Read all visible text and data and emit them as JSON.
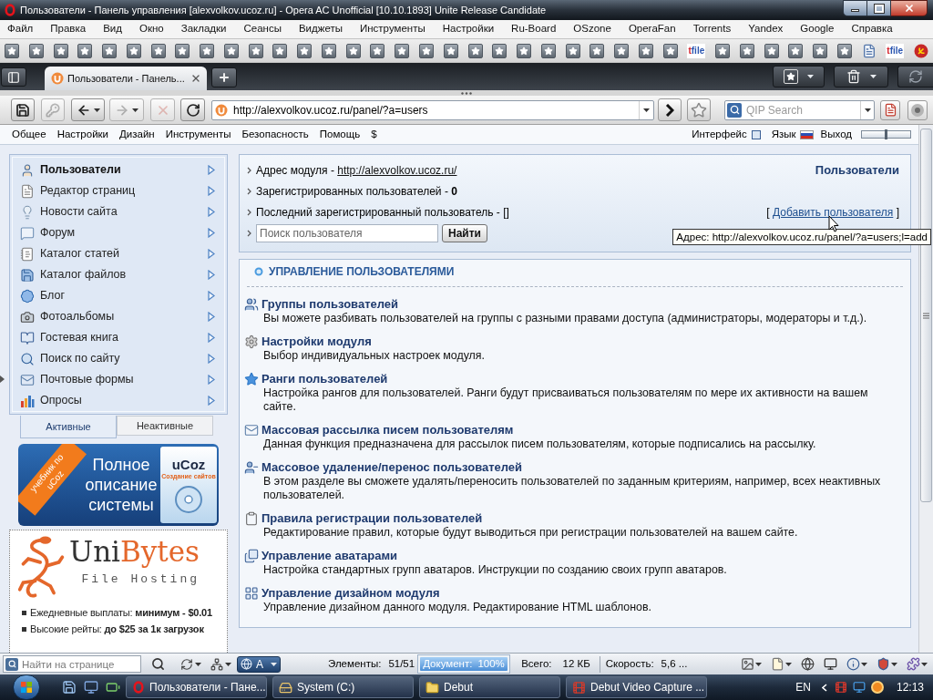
{
  "window": {
    "title": "Пользователи - Панель управления [alexvolkov.ucoz.ru] - Opera AC Unofficial [10.10.1893] Unite Release Candidate"
  },
  "menu_bar": [
    "Файл",
    "Правка",
    "Вид",
    "Окно",
    "Закладки",
    "Сеансы",
    "Виджеты",
    "Инструменты",
    "Настройки",
    "Ru-Board",
    "OSzone",
    "OperaFan",
    "Torrents",
    "Yandex",
    "Google",
    "Справка"
  ],
  "bookmarks_bar": [
    {
      "kind": "star"
    },
    {
      "kind": "star"
    },
    {
      "kind": "star"
    },
    {
      "kind": "star"
    },
    {
      "kind": "star"
    },
    {
      "kind": "star"
    },
    {
      "kind": "star"
    },
    {
      "kind": "star"
    },
    {
      "kind": "star"
    },
    {
      "kind": "star"
    },
    {
      "kind": "star"
    },
    {
      "kind": "star"
    },
    {
      "kind": "star"
    },
    {
      "kind": "star"
    },
    {
      "kind": "star"
    },
    {
      "kind": "star"
    },
    {
      "kind": "star"
    },
    {
      "kind": "star"
    },
    {
      "kind": "star"
    },
    {
      "kind": "star"
    },
    {
      "kind": "star"
    },
    {
      "kind": "star"
    },
    {
      "kind": "star"
    },
    {
      "kind": "star"
    },
    {
      "kind": "star"
    },
    {
      "kind": "star"
    },
    {
      "kind": "star"
    },
    {
      "kind": "star"
    },
    {
      "kind": "tfile",
      "label": "tfile"
    },
    {
      "kind": "star"
    },
    {
      "kind": "star"
    },
    {
      "kind": "star"
    },
    {
      "kind": "star"
    },
    {
      "kind": "star"
    },
    {
      "kind": "star"
    },
    {
      "kind": "page"
    },
    {
      "kind": "tfile",
      "label": "tfile"
    },
    {
      "kind": "emblem"
    }
  ],
  "tabs": [
    {
      "title": "Пользователи - Панель...",
      "selected": true
    }
  ],
  "toolbar": {
    "buttons": [
      {
        "kind": "save",
        "disabled": false
      },
      {
        "kind": "key",
        "disabled": true
      },
      {
        "kind": "back",
        "disabled": false
      },
      {
        "kind": "forward",
        "disabled": true
      },
      {
        "kind": "stop",
        "disabled": true
      },
      {
        "kind": "reload",
        "disabled": false
      }
    ],
    "address": "http://alexvolkov.ucoz.ru/panel/?a=users",
    "search": {
      "placeholder": "QIP Search"
    }
  },
  "site_nav": {
    "items": [
      "Общее",
      "Настройки",
      "Дизайн",
      "Инструменты",
      "Безопасность",
      "Помощь",
      "$"
    ],
    "interface": "Интерфейс",
    "language": "Язык",
    "logout": "Выход",
    "width_slider": {
      "level": 0.5
    }
  },
  "sidebar": {
    "items": [
      {
        "label": "Пользователи",
        "selected": true
      },
      {
        "label": "Редактор страниц",
        "selected": false
      },
      {
        "label": "Новости сайта",
        "selected": false
      },
      {
        "label": "Форум",
        "selected": false
      },
      {
        "label": "Каталог статей",
        "selected": false
      },
      {
        "label": "Каталог файлов",
        "selected": false
      },
      {
        "label": "Блог",
        "selected": false
      },
      {
        "label": "Фотоальбомы",
        "selected": false
      },
      {
        "label": "Гостевая книга",
        "selected": false
      },
      {
        "label": "Поиск по сайту",
        "selected": false
      },
      {
        "label": "Почтовые формы",
        "selected": false
      },
      {
        "label": "Опросы",
        "selected": false
      }
    ],
    "tabs": [
      {
        "label": "Активные",
        "selected": true
      },
      {
        "label": "Неактивные",
        "selected": false
      }
    ]
  },
  "banner": {
    "ribbon": "учебник по uCoz",
    "headline": "Полное описание системы",
    "box_title": "uCoz",
    "box_subtitle": "Создание сайтов"
  },
  "ad": {
    "brand_first": "Uni",
    "brand_second": "Bytes",
    "tagline": "File Hosting",
    "bullets": [
      "Ежедневные выплаты: **минимум - $0.01**",
      "Высокие рейты: **до $25 за 1к загрузок**"
    ]
  },
  "info_panel": {
    "address_label": "Адрес модуля -",
    "address_link": "http://alexvolkov.ucoz.ru/",
    "module_name": "Пользователи",
    "registered": "Зарегистрированных пользователей - **0**",
    "last_user": "Последний зарегистрированный пользователь - []",
    "add_user": {
      "open": "[",
      "link": "Добавить пользователя",
      "close": "]"
    },
    "search": {
      "placeholder": "Поиск пользователя",
      "button": "Найти"
    }
  },
  "tooltip": "Адрес: http://alexvolkov.ucoz.ru/panel/?a=users;l=add",
  "management": {
    "title": "УПРАВЛЕНИЕ ПОЛЬЗОВАТЕЛЯМИ",
    "items": [
      {
        "title": "Группы пользователей",
        "description": "Вы можете разбивать пользователей на группы с разными правами доступа (администраторы, модераторы и т.д.)."
      },
      {
        "title": "Настройки модуля",
        "description": "Выбор индивидуальных настроек модуля."
      },
      {
        "title": "Ранги пользователей",
        "description": "Настройка рангов для пользователей. Ранги будут присваиваться пользователям по мере их активности на вашем сайте."
      },
      {
        "title": "Массовая рассылка писем пользователям",
        "description": "Данная функция предназначена для рассылок писем пользователям, которые подписались на рассылку."
      },
      {
        "title": "Массовое удаление/перенос пользователей",
        "description": "В этом разделе вы сможете удалять/переносить пользователей по заданным критериям, например, всех неактивных пользователей."
      },
      {
        "title": "Правила регистрации пользователей",
        "description": "Редактирование правил, которые будут выводиться при регистрации пользователей на вашем сайте."
      },
      {
        "title": "Управление аватарами",
        "description": "Настройка стандартных групп аватаров. Инструкции по созданию своих групп аватаров."
      },
      {
        "title": "Управление дизайном модуля",
        "description": "Управление дизайном данного модуля. Редактирование HTML шаблонов."
      }
    ]
  },
  "status_bar": {
    "find": {
      "placeholder": "Найти на странице"
    },
    "view_button": "A",
    "elements": {
      "label": "Элементы:",
      "value": "51/51"
    },
    "document": {
      "label": "Документ:",
      "value": "100%",
      "level": 1
    },
    "total": {
      "label": "Всего:",
      "value": "12 КБ"
    },
    "speed": {
      "label": "Скорость:",
      "value": "5,6 ..."
    }
  },
  "taskbar": {
    "tasks": [
      {
        "title": "Пользователи - Пане..."
      },
      {
        "title": "System (C:)"
      },
      {
        "title": "Debut"
      },
      {
        "title": "Debut Video Capture ..."
      }
    ],
    "language": "EN",
    "clock": "12:13"
  }
}
